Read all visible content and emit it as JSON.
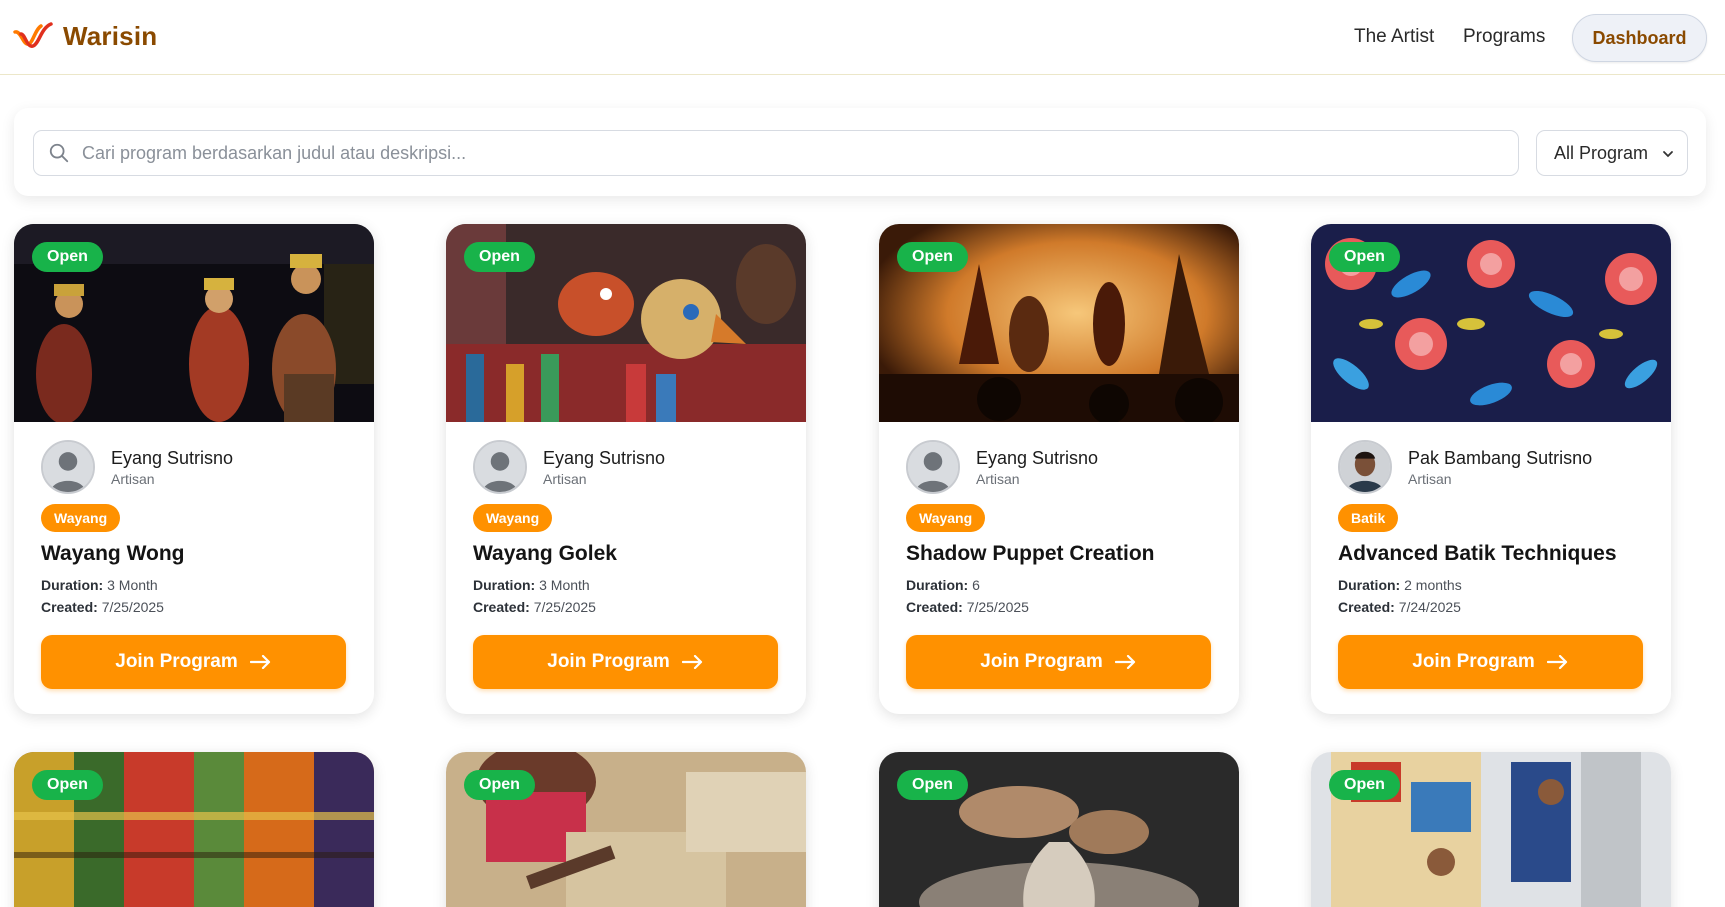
{
  "header": {
    "brand": "Warisin",
    "nav": {
      "artist": "The Artist",
      "programs": "Programs",
      "dashboard": "Dashboard"
    }
  },
  "search": {
    "placeholder": "Cari program berdasarkan judul atau deskripsi...",
    "filter_selected": "All Program"
  },
  "colors": {
    "accent": "#ff9100",
    "brand": "#8a4a00",
    "open_badge": "#18b34a"
  },
  "labels": {
    "duration": "Duration:",
    "created": "Created:",
    "join": "Join Program"
  },
  "cards": [
    {
      "status": "Open",
      "artist": "Eyang Sutrisno",
      "role": "Artisan",
      "category": "Wayang",
      "title": "Wayang Wong",
      "duration": "3 Month",
      "created": "7/25/2025",
      "image": "wayang-wong-dancers",
      "avatar": "default-avatar"
    },
    {
      "status": "Open",
      "artist": "Eyang Sutrisno",
      "role": "Artisan",
      "category": "Wayang",
      "title": "Wayang Golek",
      "duration": "3 Month",
      "created": "7/25/2025",
      "image": "wayang-golek-puppets",
      "avatar": "default-avatar"
    },
    {
      "status": "Open",
      "artist": "Eyang Sutrisno",
      "role": "Artisan",
      "category": "Wayang",
      "title": "Shadow Puppet Creation",
      "duration": "6",
      "created": "7/25/2025",
      "image": "shadow-puppet-stage",
      "avatar": "default-avatar"
    },
    {
      "status": "Open",
      "artist": "Pak Bambang Sutrisno",
      "role": "Artisan",
      "category": "Batik",
      "title": "Advanced Batik Techniques",
      "duration": "2 months",
      "created": "7/24/2025",
      "image": "batik-floral-fabric",
      "avatar": "photo-avatar"
    },
    {
      "status": "Open",
      "image": "woven-textiles"
    },
    {
      "status": "Open",
      "image": "wood-carving"
    },
    {
      "status": "Open",
      "image": "pottery-wheel"
    },
    {
      "status": "Open",
      "image": "mural-artists"
    }
  ]
}
